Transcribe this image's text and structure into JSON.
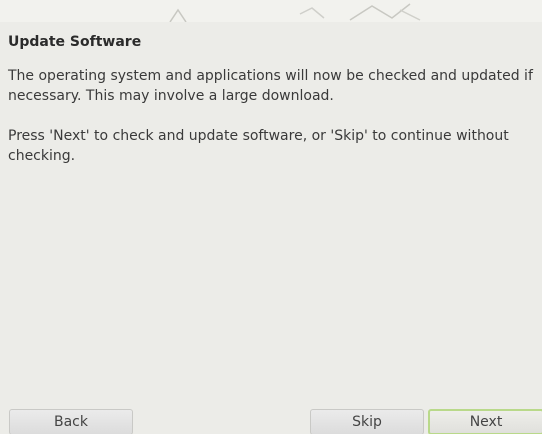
{
  "page": {
    "title": "Update Software",
    "paragraphs": [
      "The operating system and applications will now be checked and updated if necessary. This may involve a large download.",
      "Press 'Next' to check and update software, or 'Skip' to continue without checking."
    ]
  },
  "buttons": {
    "back_label": "Back",
    "skip_label": "Skip",
    "next_label": "Next"
  },
  "colors": {
    "background": "#ecece8",
    "focus_ring": "#b9d98a"
  }
}
